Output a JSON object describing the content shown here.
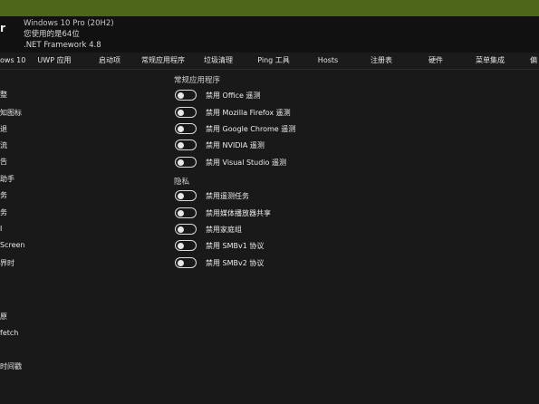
{
  "header": {
    "app_letter": "r",
    "os_version": "Windows 10 Pro (20H2)",
    "bits_text": "您使用的是64位",
    "framework": ".NET Framework 4.8"
  },
  "nav": {
    "tabs": [
      {
        "label": "ows 10"
      },
      {
        "label": "UWP 应用"
      },
      {
        "label": "启动项"
      },
      {
        "label": "常规应用程序"
      },
      {
        "label": "垃圾清理"
      },
      {
        "label": "Ping 工具"
      },
      {
        "label": "Hosts"
      },
      {
        "label": "注册表"
      },
      {
        "label": "硬件"
      },
      {
        "label": "菜单集成"
      },
      {
        "label": "偏"
      }
    ]
  },
  "left_panel": {
    "items": [
      {
        "label": "整"
      },
      {
        "label": "知图标"
      },
      {
        "label": "退"
      },
      {
        "label": "流"
      },
      {
        "label": "告"
      },
      {
        "label": "助手"
      },
      {
        "label": "务"
      },
      {
        "label": "务"
      },
      {
        "label": "I"
      },
      {
        "label": "Screen"
      },
      {
        "label": "界时"
      },
      {
        "label": "原"
      },
      {
        "label": "fetch"
      },
      {
        "label": "时间戳"
      }
    ]
  },
  "sections": {
    "apps": {
      "title": "常规应用程序",
      "toggles": [
        {
          "label": "禁用 Office 遥测",
          "on": false
        },
        {
          "label": "禁用 Mozilla Firefox 遥测",
          "on": false
        },
        {
          "label": "禁用 Google Chrome 遥测",
          "on": false
        },
        {
          "label": "禁用 NVIDIA 遥测",
          "on": false
        },
        {
          "label": "禁用 Visual Studio 遥测",
          "on": false
        }
      ]
    },
    "privacy": {
      "title": "隐私",
      "toggles": [
        {
          "label": "禁用遥测任务",
          "on": false
        },
        {
          "label": "禁用媒体播放器共享",
          "on": false
        },
        {
          "label": "禁用家庭组",
          "on": false
        },
        {
          "label": "禁用 SMBv1 协议",
          "on": false
        },
        {
          "label": "禁用 SMBv2 协议",
          "on": false
        }
      ]
    }
  },
  "colors": {
    "titlebar": "#4d6619",
    "background": "#191919",
    "header": "#111111"
  }
}
